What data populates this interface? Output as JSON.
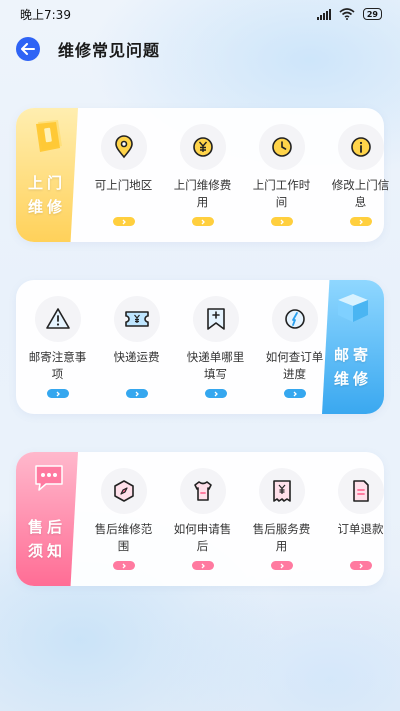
{
  "status_bar": {
    "time": "晚上7:39",
    "battery": "29"
  },
  "header": {
    "title": "维修常见问题"
  },
  "sections": [
    {
      "tag": "上门维修",
      "items": [
        {
          "label": "可上门地区",
          "icon": "location-pin-icon"
        },
        {
          "label": "上门维修费用",
          "icon": "yuan-coin-icon"
        },
        {
          "label": "上门工作时间",
          "icon": "clock-icon"
        },
        {
          "label": "修改上门信息",
          "icon": "info-icon"
        }
      ]
    },
    {
      "tag": "邮寄维修",
      "items": [
        {
          "label": "邮寄注意事项",
          "icon": "warning-icon"
        },
        {
          "label": "快递运费",
          "icon": "ticket-icon"
        },
        {
          "label": "快递单哪里填写",
          "icon": "bookmark-plus-icon"
        },
        {
          "label": "如何查订单进度",
          "icon": "compass-icon"
        }
      ]
    },
    {
      "tag": "售后须知",
      "items": [
        {
          "label": "售后维修范围",
          "icon": "hexagon-compass-icon"
        },
        {
          "label": "如何申请售后",
          "icon": "shirt-icon"
        },
        {
          "label": "售后服务费用",
          "icon": "receipt-icon"
        },
        {
          "label": "订单退款",
          "icon": "document-icon"
        }
      ]
    }
  ],
  "colors": {
    "accent_blue": "#2e63f5",
    "yellow": "#ffcf3e",
    "blue": "#35a7ef",
    "pink": "#ff7aa0",
    "icon_stroke": "#222222"
  }
}
